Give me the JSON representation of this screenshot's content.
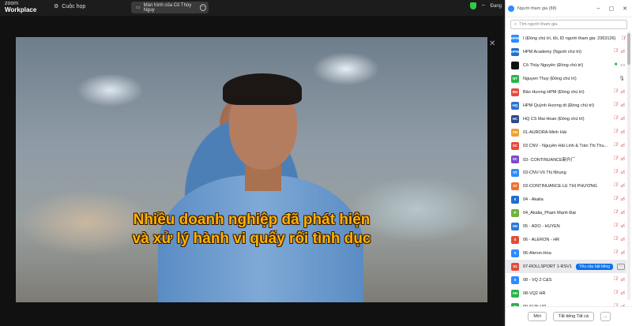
{
  "app": {
    "logo_line1": "zoom",
    "logo_line2": "Workplace",
    "meetings_label": "Cuộc họp",
    "screen_share_label": "Màn hình của Cô Thùy Nguy",
    "top_right_label": "Đang"
  },
  "video": {
    "subtitle_line1": "Nhiều doanh nghiệp đã phát hiện",
    "subtitle_line2": "và xử lý hành vi quấy rối tình dục"
  },
  "panel": {
    "title": "Người tham gia (88)",
    "search_placeholder": "Tìm người tham gia",
    "participants": [
      {
        "avatar": "HPM",
        "color": "#2d8cff",
        "name": "I (Đồng chủ trì, tôi, ID người tham gia: 2363126)",
        "icons": "mic-muted"
      },
      {
        "avatar": "HPM",
        "color": "#1f6fcf",
        "name": "HPM Academy (Người chủ trì)",
        "icons": "mic-muted cam-off"
      },
      {
        "avatar": "",
        "color": "#111111",
        "name": "Cô Thùy Nguyễn (Đồng chủ trì)",
        "icons": "share cam-on"
      },
      {
        "avatar": "NT",
        "color": "#2ab34b",
        "name": "Nguyen Thuy (Đồng chủ trì)",
        "icons": "mic"
      },
      {
        "avatar": "BH",
        "color": "#e24c3c",
        "name": "Bảo Hương HPM (Đồng chủ trì)",
        "icons": "mic-muted cam-off"
      },
      {
        "avatar": "HQ",
        "color": "#2d6fd4",
        "name": "HPM Quỳnh Hương dt (Đồng chủ trì)",
        "icons": "mic-muted cam-off"
      },
      {
        "avatar": "HC",
        "color": "#2b4a8a",
        "name": "HQ CS Mai Hoan (Đồng chủ trì)",
        "icons": "mic-muted cam-off"
      },
      {
        "avatar": "0H",
        "color": "#f0a030",
        "name": "01-AURORA-Minh Hải",
        "icons": "mic-muted cam-off"
      },
      {
        "avatar": "0C",
        "color": "#e24c3c",
        "name": "03 CNV - Nguyễn Hải Linh & Trần Thị Thu...",
        "icons": "mic-muted cam-off"
      },
      {
        "avatar": "0C",
        "color": "#7a4bc9",
        "name": "03- CONTINUANCE新升厂",
        "icons": "mic-muted cam-off"
      },
      {
        "avatar": "0T",
        "color": "#2d8cff",
        "name": "03-CNV-Vũ Thị Nhung",
        "icons": "mic-muted cam-off"
      },
      {
        "avatar": "0T",
        "color": "#f07030",
        "name": "03-CONTINUANCE-LÊ THỊ PHƯƠNG",
        "icons": "mic-muted cam-off"
      },
      {
        "avatar": "0",
        "color": "#1f6fcf",
        "name": "04 - Akalia",
        "icons": "mic-muted cam-off"
      },
      {
        "avatar": "P",
        "color": "#6fb33f",
        "name": "04_Akalia_Phạm Mạnh Đạt",
        "icons": "mic-muted cam-off"
      },
      {
        "avatar": "0H",
        "color": "#2b7bd4",
        "name": "05 - ADO - HUYEN",
        "icons": "mic-muted cam-off"
      },
      {
        "avatar": "0",
        "color": "#e24c3c",
        "name": "06 - ALERON - HR",
        "icons": "mic-muted cam-off"
      },
      {
        "avatar": "0",
        "color": "#2d8cff",
        "name": "06-Aleron-Hoa",
        "icons": "mic-muted cam-off"
      },
      {
        "avatar": "01",
        "color": "#e24c3c",
        "name": "07-ROLLSPORT 1-RSV1",
        "icons": "request",
        "highlight": true
      },
      {
        "avatar": "0",
        "color": "#2d8cff",
        "name": "08 - VQ 2 C&S",
        "icons": "mic-muted cam-off"
      },
      {
        "avatar": "0H",
        "color": "#2ab34b",
        "name": "08-VQ2 HR",
        "icons": "mic-muted cam-off"
      },
      {
        "avatar": "0",
        "color": "#2ab34b",
        "name": "09-SUN-HR",
        "icons": "mic-muted cam-off"
      }
    ],
    "request_label": "Yêu cầu bật tiếng",
    "invite_label": "Mời",
    "mute_all_label": "Tắt tiếng Tất cả",
    "more_label": "..."
  }
}
